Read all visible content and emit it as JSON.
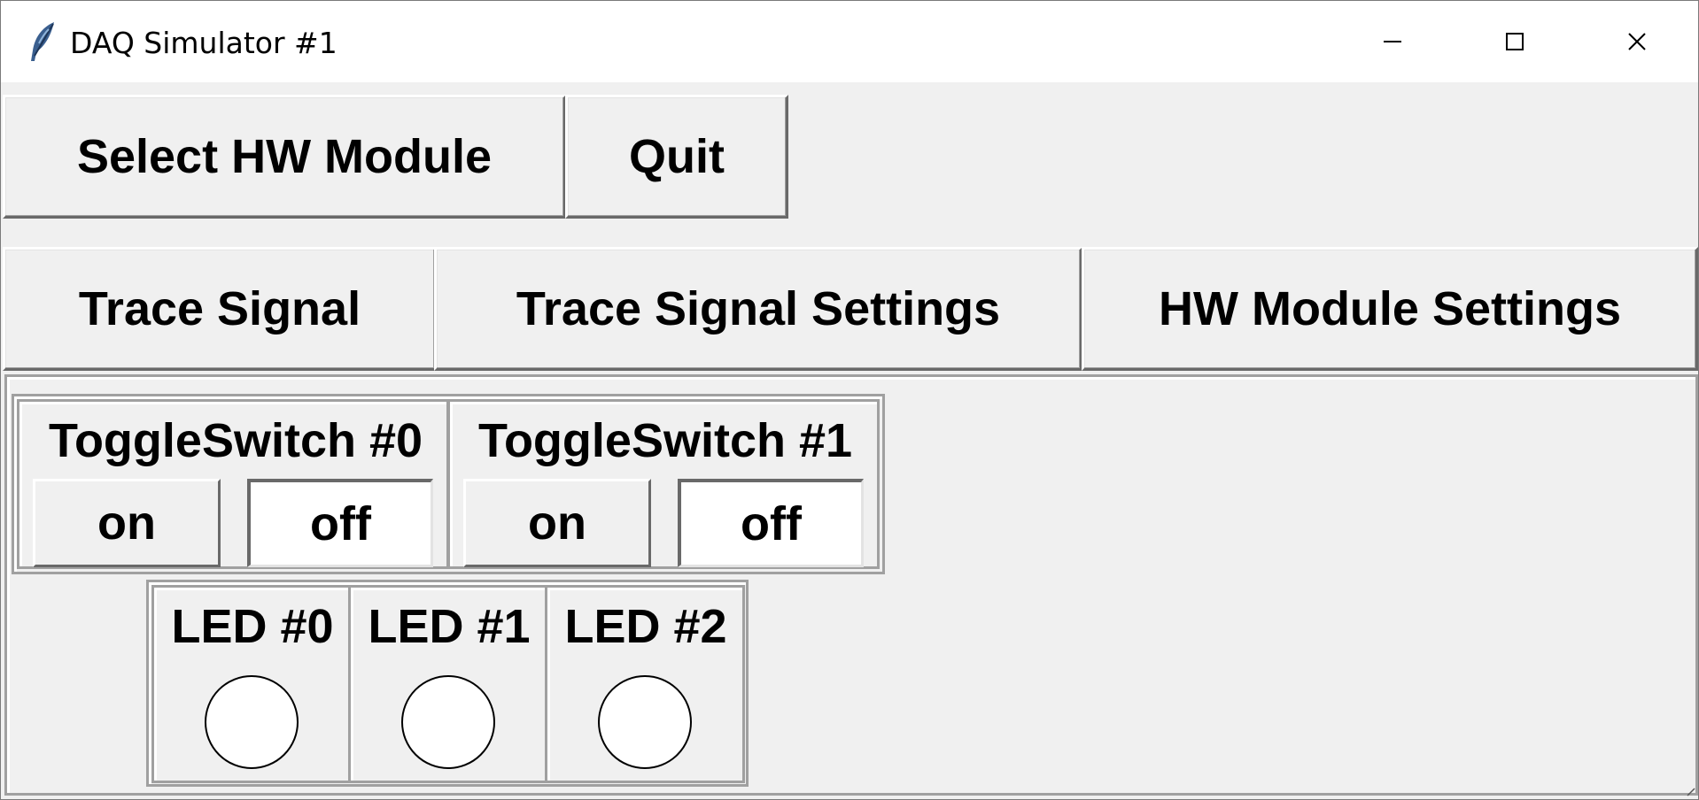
{
  "window": {
    "title": "DAQ Simulator #1",
    "icon": "feather-icon",
    "controls": {
      "minimize_icon": "minimize-icon",
      "maximize_icon": "maximize-icon",
      "close_icon": "close-icon"
    }
  },
  "toolbar_row1": {
    "select_hw_module": "Select HW Module",
    "quit": "Quit"
  },
  "toolbar_row2": {
    "trace_signal": "Trace Signal",
    "trace_signal_settings": "Trace Signal Settings",
    "hw_module_settings": "HW Module Settings"
  },
  "toggle_switches": [
    {
      "label": "ToggleSwitch #0",
      "on_label": "on",
      "off_label": "off",
      "state": "off"
    },
    {
      "label": "ToggleSwitch #1",
      "on_label": "on",
      "off_label": "off",
      "state": "off"
    }
  ],
  "leds": [
    {
      "label": "LED #0",
      "state": "off"
    },
    {
      "label": "LED #1",
      "state": "off"
    },
    {
      "label": "LED #2",
      "state": "off"
    }
  ],
  "colors": {
    "background": "#f0f0f0",
    "titlebar": "#ffffff",
    "led_off": "#ffffff"
  }
}
